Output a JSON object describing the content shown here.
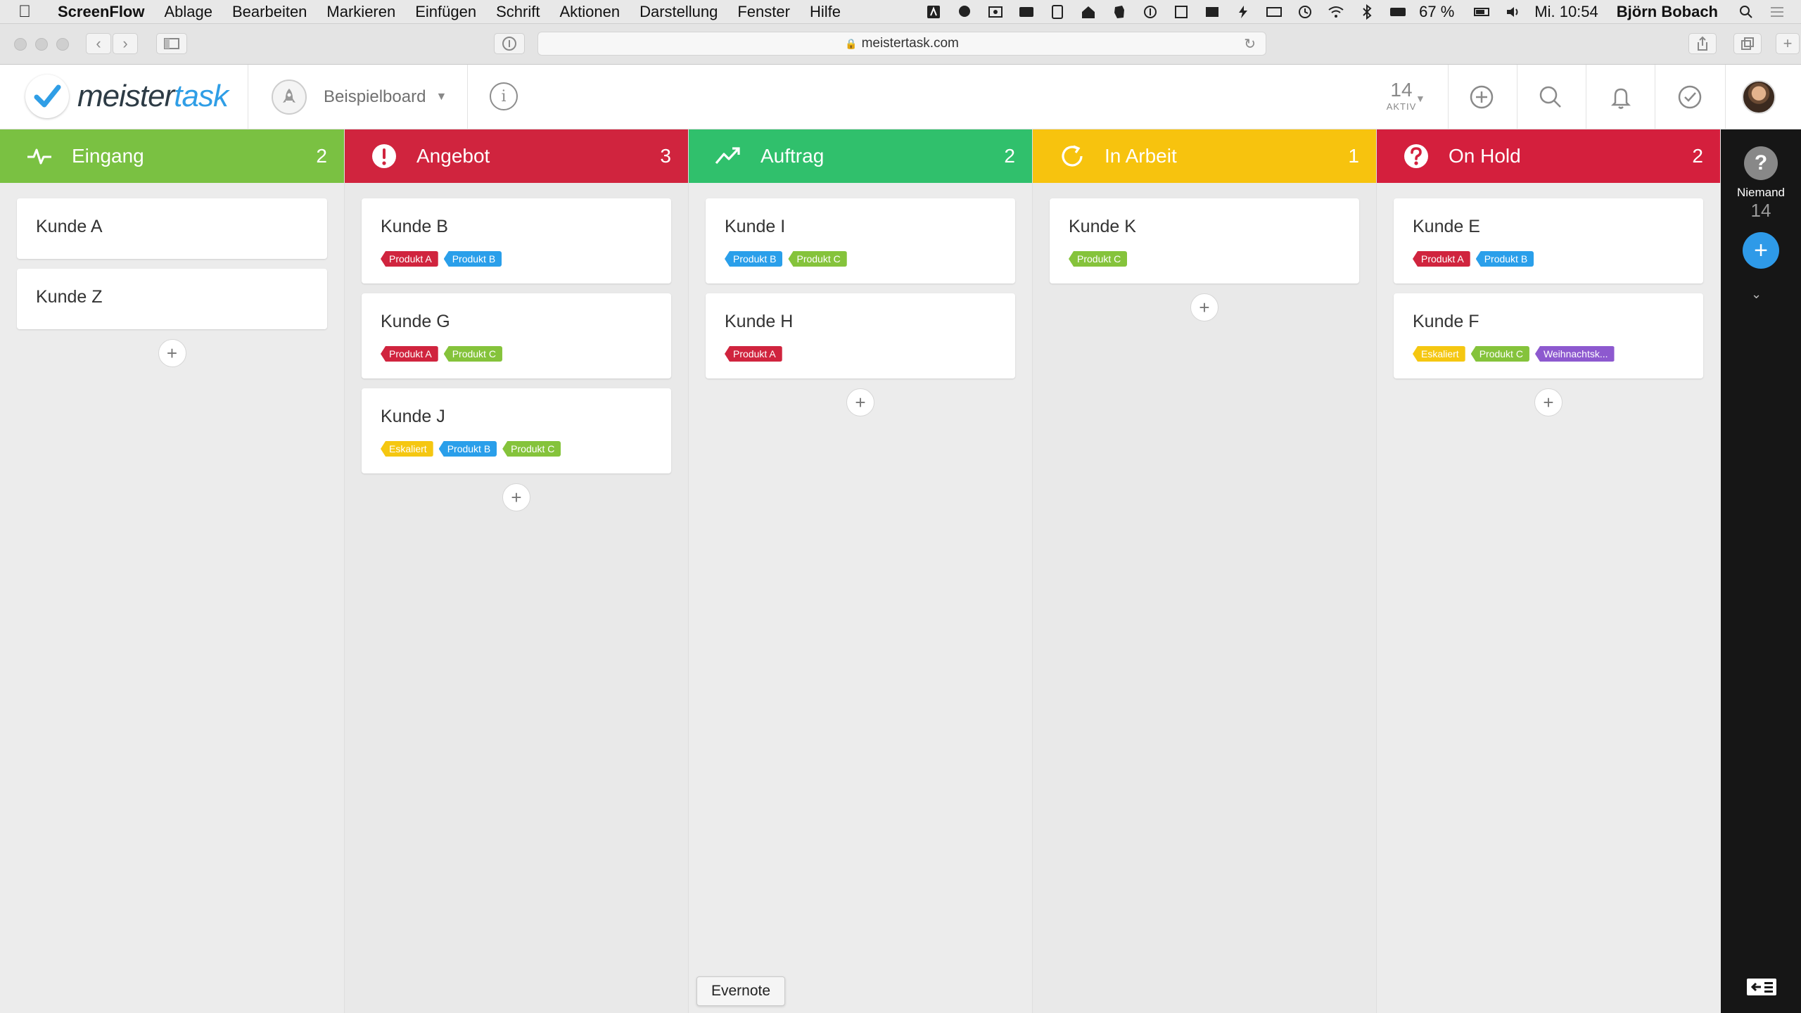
{
  "menubar": {
    "app_name": "ScreenFlow",
    "items": [
      "Ablage",
      "Bearbeiten",
      "Markieren",
      "Einfügen",
      "Schrift",
      "Aktionen",
      "Darstellung",
      "Fenster",
      "Hilfe"
    ],
    "battery": "67 %",
    "clock": "Mi. 10:54",
    "user": "Björn Bobach"
  },
  "browser": {
    "url": "meistertask.com"
  },
  "header": {
    "logo_part1": "meister",
    "logo_part2": "task",
    "board_name": "Beispielboard",
    "info_glyph": "i",
    "active_count": "14",
    "active_label": "AKTIV"
  },
  "colors": {
    "eingang": "#7ac142",
    "angebot": "#d0243e",
    "auftrag": "#30c06c",
    "in_arbeit": "#f7c30e",
    "on_hold": "#d41f3d",
    "sidebar": "#161616",
    "accent": "#2e9ae8"
  },
  "columns": [
    {
      "title": "Eingang",
      "count": "2",
      "icon": "pulse-icon",
      "cards": [
        {
          "title": "Kunde A",
          "tags": []
        },
        {
          "title": "Kunde Z",
          "tags": []
        }
      ]
    },
    {
      "title": "Angebot",
      "count": "3",
      "icon": "exclamation-icon",
      "cards": [
        {
          "title": "Kunde B",
          "tags": [
            {
              "label": "Produkt A",
              "color": "red"
            },
            {
              "label": "Produkt B",
              "color": "blue"
            }
          ]
        },
        {
          "title": "Kunde G",
          "tags": [
            {
              "label": "Produkt A",
              "color": "red"
            },
            {
              "label": "Produkt C",
              "color": "green"
            }
          ]
        },
        {
          "title": "Kunde J",
          "tags": [
            {
              "label": "Eskaliert",
              "color": "yellow"
            },
            {
              "label": "Produkt B",
              "color": "blue"
            },
            {
              "label": "Produkt C",
              "color": "green"
            }
          ]
        }
      ]
    },
    {
      "title": "Auftrag",
      "count": "2",
      "icon": "trend-up-icon",
      "cards": [
        {
          "title": "Kunde I",
          "tags": [
            {
              "label": "Produkt B",
              "color": "blue"
            },
            {
              "label": "Produkt C",
              "color": "green"
            }
          ]
        },
        {
          "title": "Kunde H",
          "tags": [
            {
              "label": "Produkt A",
              "color": "red"
            }
          ]
        }
      ]
    },
    {
      "title": "In Arbeit",
      "count": "1",
      "icon": "refresh-icon",
      "cards": [
        {
          "title": "Kunde K",
          "tags": [
            {
              "label": "Produkt C",
              "color": "green"
            }
          ]
        }
      ]
    },
    {
      "title": "On Hold",
      "count": "2",
      "icon": "question-icon",
      "cards": [
        {
          "title": "Kunde E",
          "tags": [
            {
              "label": "Produkt A",
              "color": "red"
            },
            {
              "label": "Produkt B",
              "color": "blue"
            }
          ]
        },
        {
          "title": "Kunde F",
          "tags": [
            {
              "label": "Eskaliert",
              "color": "yellow"
            },
            {
              "label": "Produkt C",
              "color": "green"
            },
            {
              "label": "Weihnachtsk...",
              "color": "purple"
            }
          ]
        }
      ]
    }
  ],
  "sidebar": {
    "help_glyph": "?",
    "assignee_label": "Niemand",
    "assignee_count": "14",
    "add_glyph": "+",
    "chevron_glyph": "⌄"
  },
  "add_card_glyph": "+",
  "tooltip": "Evernote"
}
